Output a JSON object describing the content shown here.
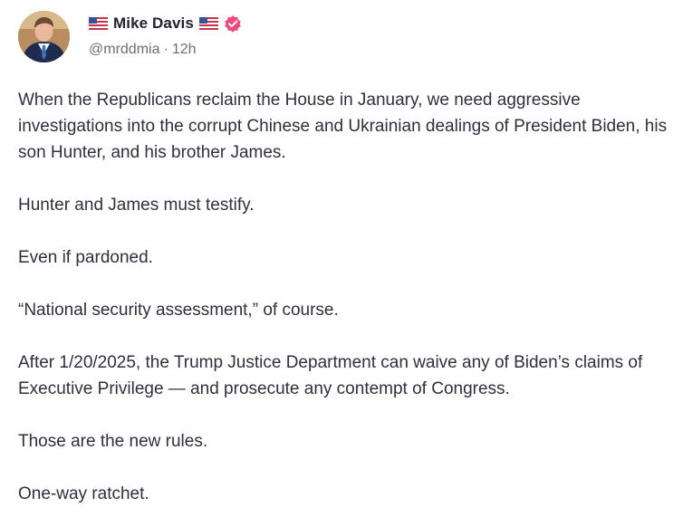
{
  "author": {
    "display_name": "Mike Davis",
    "handle": "@mrddmia",
    "separator": "·",
    "time": "12h",
    "flag_icon": "us-flag-icon",
    "badge_icon": "verified-badge-icon",
    "badge_color": "#ec4a7c"
  },
  "post": {
    "paragraphs": [
      "When the Republicans reclaim the House in January, we need aggressive investigations into the corrupt Chinese and Ukrainian dealings of President Biden, his son Hunter, and his brother James.",
      "Hunter and James must testify.",
      "Even if pardoned.",
      "“National security assessment,” of course.",
      "After 1/20/2025, the Trump Justice Department can waive any of Biden’s claims of Executive Privilege — and prosecute any contempt of Congress.",
      "Those are the new rules.",
      "One-way ratchet."
    ]
  }
}
